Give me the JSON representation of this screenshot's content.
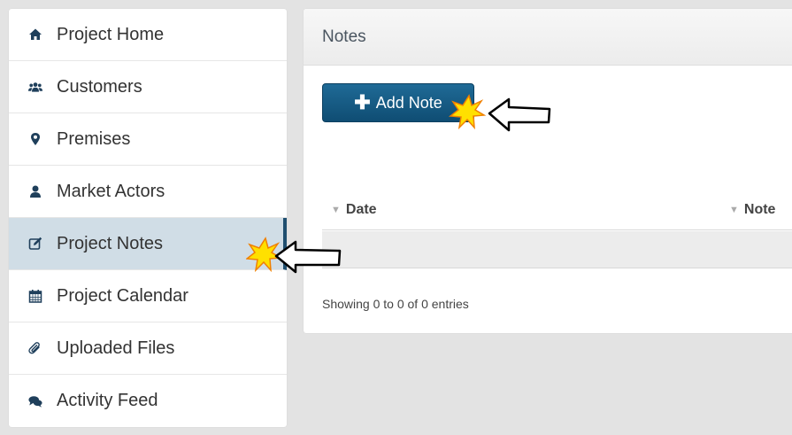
{
  "sidebar": {
    "items": [
      {
        "label": "Project Home",
        "icon": "home-icon",
        "active": false
      },
      {
        "label": "Customers",
        "icon": "users-icon",
        "active": false
      },
      {
        "label": "Premises",
        "icon": "map-marker-icon",
        "active": false
      },
      {
        "label": "Market Actors",
        "icon": "user-icon",
        "active": false
      },
      {
        "label": "Project Notes",
        "icon": "edit-icon",
        "active": true
      },
      {
        "label": "Project Calendar",
        "icon": "calendar-icon",
        "active": false
      },
      {
        "label": "Uploaded Files",
        "icon": "paperclip-icon",
        "active": false
      },
      {
        "label": "Activity Feed",
        "icon": "comments-icon",
        "active": false
      }
    ]
  },
  "panel": {
    "title": "Notes",
    "add_button_label": "Add Note",
    "table": {
      "columns": [
        "Date",
        "Note"
      ],
      "rows": []
    },
    "entries_info": "Showing 0 to 0 of 0 entries"
  },
  "colors": {
    "accent": "#0f4d73",
    "active_bg": "#d0dde6",
    "active_border": "#1f4f70",
    "icon": "#1f3f5b"
  }
}
